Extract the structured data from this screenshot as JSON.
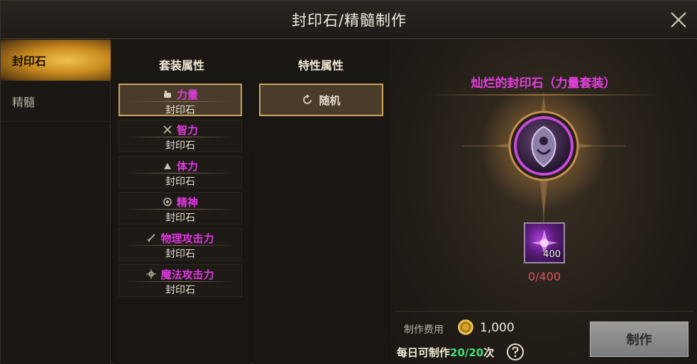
{
  "window": {
    "title": "封印石/精髓制作"
  },
  "sidebar": {
    "tabs": [
      {
        "label": "封印石",
        "active": true
      },
      {
        "label": "精髓",
        "active": false
      }
    ]
  },
  "columns": {
    "set_header": "套装属性",
    "trait_header": "特性属性"
  },
  "set_attributes": [
    {
      "icon": "fist-icon",
      "label": "力量",
      "sub": "封印石",
      "selected": true
    },
    {
      "icon": "crossed-swords-icon",
      "label": "智力",
      "sub": "封印石",
      "selected": false
    },
    {
      "icon": "heart-icon",
      "label": "体力",
      "sub": "封印石",
      "selected": false
    },
    {
      "icon": "orb-icon",
      "label": "精神",
      "sub": "封印石",
      "selected": false
    },
    {
      "icon": "sword-icon",
      "label": "物理攻击力",
      "sub": "封印石",
      "selected": false
    },
    {
      "icon": "magic-star-icon",
      "label": "魔法攻击力",
      "sub": "封印石",
      "selected": false
    }
  ],
  "trait": {
    "icon": "refresh-icon",
    "label": "随机"
  },
  "result": {
    "title": "灿烂的封印石（力量套装）",
    "emblem_icon": "seal-stone-emblem-icon"
  },
  "material": {
    "icon": "purple-essence-icon",
    "count": "400",
    "progress": "0/400"
  },
  "footer": {
    "cost_label": "制作费用",
    "cost_value": "1,000",
    "daily_label": "每日可制作",
    "daily_count": "20/20",
    "daily_suffix": "次",
    "craft_button": "制作"
  },
  "colors": {
    "accent_gold": "#c9a35e",
    "attr_magenta": "#e03ae0",
    "progress_red": "#e05565",
    "daily_green": "#3ee07a"
  }
}
